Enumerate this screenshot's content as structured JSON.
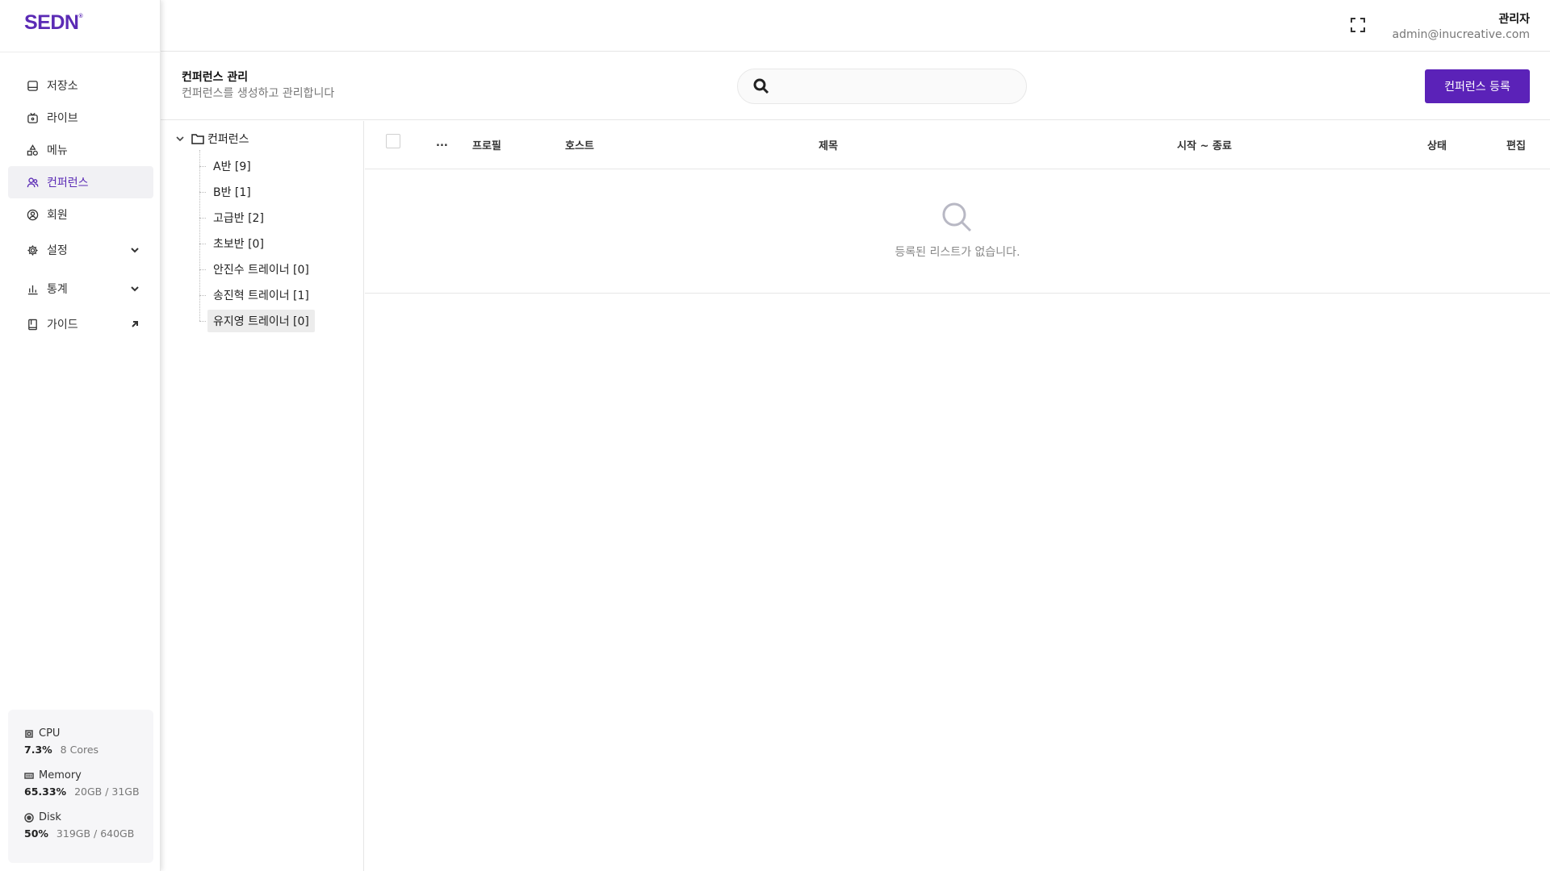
{
  "app": {
    "logo": "SEDN",
    "logo_mark": "®"
  },
  "colors": {
    "brand": "#5b22b8",
    "active_bg": "#f1f1f4"
  },
  "sidebar": {
    "items": [
      {
        "label": "저장소",
        "icon": "storage-icon"
      },
      {
        "label": "라이브",
        "icon": "live-tv-icon"
      },
      {
        "label": "메뉴",
        "icon": "menu-shapes-icon"
      },
      {
        "label": "컨퍼런스",
        "icon": "conference-people-icon",
        "active": true
      },
      {
        "label": "회원",
        "icon": "member-icon"
      },
      {
        "label": "설정",
        "icon": "gear-icon",
        "trail": "chevron-down-icon"
      },
      {
        "label": "통계",
        "icon": "bar-chart-icon",
        "trail": "chevron-down-icon"
      },
      {
        "label": "가이드",
        "icon": "guide-book-icon",
        "trail": "external-arrow-icon"
      }
    ]
  },
  "system": {
    "cpu": {
      "label": "CPU",
      "percent": "7.3%",
      "detail": "8 Cores"
    },
    "memory": {
      "label": "Memory",
      "percent": "65.33%",
      "detail": "20GB / 31GB"
    },
    "disk": {
      "label": "Disk",
      "percent": "50%",
      "detail": "319GB / 640GB"
    }
  },
  "header": {
    "user_name": "관리자",
    "user_email": "admin@inucreative.com"
  },
  "page": {
    "title": "컨퍼런스 관리",
    "subtitle": "컨퍼런스를 생성하고 관리합니다",
    "search_placeholder": "",
    "primary_button": "컨퍼런스 등록"
  },
  "tree": {
    "root": "컨퍼런스",
    "children": [
      {
        "label": "A반 [9]"
      },
      {
        "label": "B반 [1]"
      },
      {
        "label": "고급반 [2]"
      },
      {
        "label": "초보반 [0]"
      },
      {
        "label": "안진수 트레이너 [0]"
      },
      {
        "label": "송진혁 트레이너 [1]"
      },
      {
        "label": "유지영 트레이너 [0]",
        "selected": true
      }
    ]
  },
  "table": {
    "columns": {
      "more": "...",
      "profile": "프로필",
      "host": "호스트",
      "title": "제목",
      "period": "시작 ~ 종료",
      "status": "상태",
      "edit": "편집"
    },
    "empty_message": "등록된 리스트가 없습니다."
  }
}
